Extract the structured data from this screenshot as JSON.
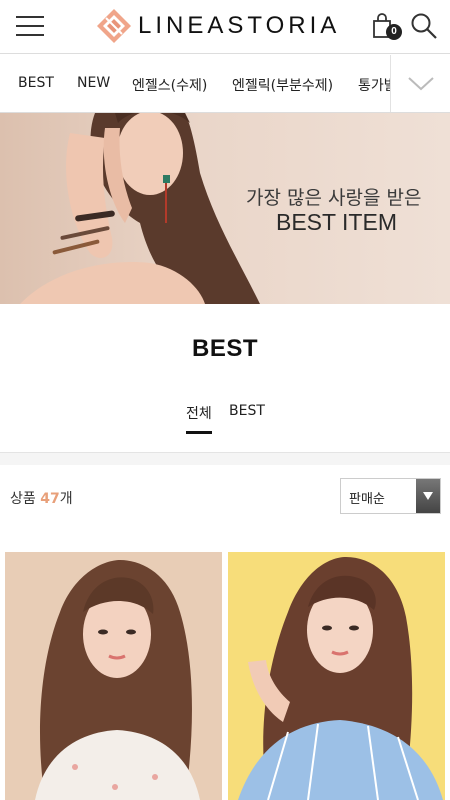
{
  "header": {
    "logo_text": "LINEASTORIA",
    "cart_count": "0",
    "brand_color": "#e8957a"
  },
  "categories": {
    "items": [
      {
        "label": "BEST"
      },
      {
        "label": "NEW"
      },
      {
        "label": "엔젤스(수제)"
      },
      {
        "label": "엔젤릭(부분수제)"
      },
      {
        "label": "통가발"
      }
    ]
  },
  "banner": {
    "subtitle": "가장 많은 사랑을 받은",
    "title": "BEST ITEM"
  },
  "page": {
    "title": "BEST",
    "tabs": [
      {
        "label": "전체",
        "active": true
      },
      {
        "label": "BEST",
        "active": false
      }
    ]
  },
  "listing": {
    "count_prefix": "상품",
    "count": "47",
    "count_suffix": "개",
    "count_color": "#e8a07a",
    "sort_selected": "판매순"
  },
  "icons": {
    "menu": "hamburger-menu-icon",
    "cart": "shopping-bag-icon",
    "search": "search-icon",
    "expand": "chevron-down-icon"
  }
}
